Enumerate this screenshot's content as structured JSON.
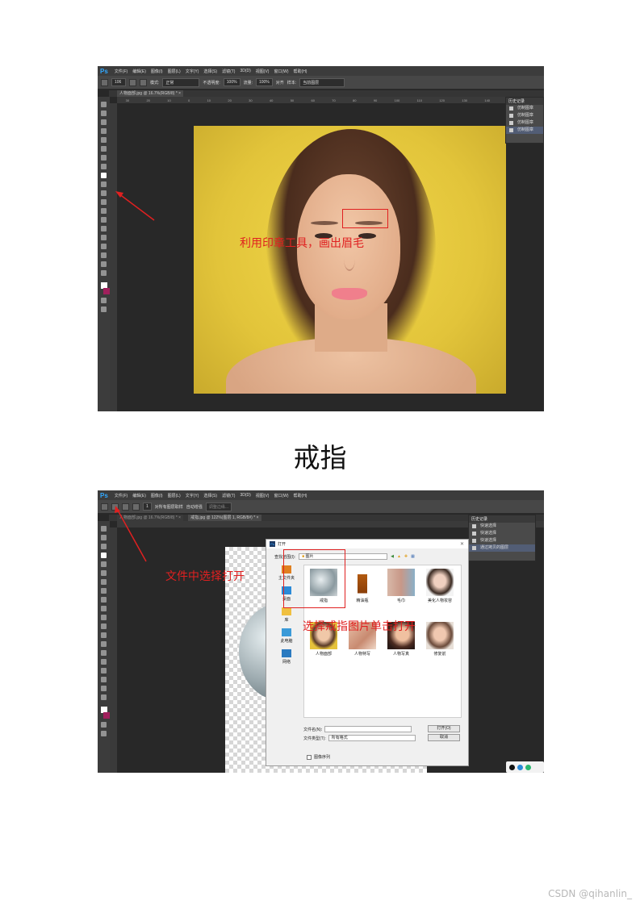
{
  "screenshot1": {
    "app_logo": "Ps",
    "menus": [
      "文件(F)",
      "编辑(E)",
      "图像(I)",
      "图层(L)",
      "文字(Y)",
      "选择(S)",
      "滤镜(T)",
      "3D(D)",
      "视图(V)",
      "窗口(W)",
      "帮助(H)"
    ],
    "options": {
      "brush_size": "106",
      "mode_label": "模式:",
      "mode_value": "正常",
      "opacity_label": "不透明度:",
      "opacity_value": "100%",
      "flow_label": "流量:",
      "flow_value": "100%",
      "align_label": "对齐",
      "sample_label": "样本:",
      "sample_value": "当前图层"
    },
    "tab": "人物面部.jpg @ 16.7%(RGB/8) * ×",
    "ruler": [
      "30",
      "20",
      "10",
      "0",
      "10",
      "20",
      "30",
      "40",
      "50",
      "60",
      "70",
      "80",
      "90",
      "100",
      "110",
      "120",
      "130",
      "140",
      "150",
      "160"
    ],
    "history": {
      "title": "历史记录",
      "rows": [
        "仿制图章",
        "仿制图章",
        "仿制图章",
        "仿制图章"
      ]
    },
    "annotation": "利用印章工具，画出眉毛"
  },
  "heading": "戒指",
  "screenshot2": {
    "app_logo": "Ps",
    "menus": [
      "文件(F)",
      "编辑(E)",
      "图像(I)",
      "图层(L)",
      "文字(Y)",
      "选择(S)",
      "滤镜(T)",
      "3D(D)",
      "视图(V)",
      "窗口(W)",
      "帮助(H)"
    ],
    "options": {
      "brush_size": "1",
      "all_layers": "对所有图层取样",
      "auto_enhance": "自动增强",
      "refine_edge": "调整边缘..."
    },
    "tabs": [
      "人物面部.jpg @ 16.7%(RGB/8) * ×",
      "戒指.jpg @ 122%(图层 1, RGB/8#) * ×"
    ],
    "history": {
      "title": "历史记录",
      "rows": [
        "快速选择",
        "快速选择",
        "快速选择",
        "通过拷贝的图层"
      ]
    },
    "dialog": {
      "title": "打开",
      "look_in_label": "查找范围(I):",
      "look_in_value": "图片",
      "sidebar": [
        "主文件夹",
        "桌面",
        "库",
        "此电脑",
        "网络"
      ],
      "files": [
        "戒指",
        "精油瓶",
        "毛巾",
        "美化人物妆容",
        "人物面部",
        "人物特写",
        "人物写真",
        "修复前"
      ],
      "filename_label": "文件名(N):",
      "filetype_label": "文件类型(T):",
      "filetype_value": "所有格式",
      "open_button": "打开(O)",
      "cancel_button": "取消",
      "sequence_label": "图像序列"
    },
    "annotation_left": "文件中选择打开",
    "annotation_dialog": "选择戒指图片单击打开"
  },
  "watermark": "CSDN @qihanlin_",
  "colors": {
    "annotation": "#e02020",
    "ps_accent": "#31a8ff",
    "photo_background": "#e2c43a"
  }
}
